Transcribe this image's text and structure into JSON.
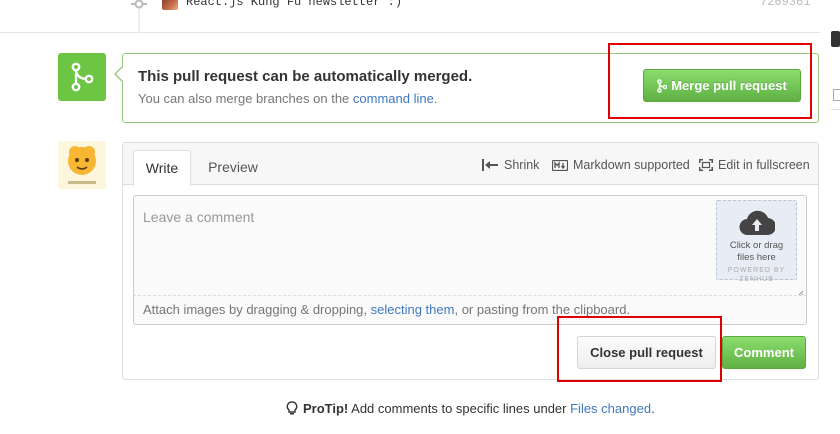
{
  "commit": {
    "message": "React.js Kung Fu newsletter :)",
    "sha": "7269361"
  },
  "merge": {
    "title": "This pull request can be automatically merged.",
    "subtitle_prefix": "You can also merge branches on the ",
    "subtitle_link": "command line",
    "subtitle_suffix": ".",
    "button_label": "Merge pull request"
  },
  "comment_form": {
    "tabs": [
      "Write",
      "Preview"
    ],
    "tools": {
      "shrink": "Shrink",
      "markdown": "Markdown supported",
      "fullscreen": "Edit in fullscreen"
    },
    "placeholder": "Leave a comment",
    "upload": {
      "text_line1": "Click or drag",
      "text_line2": "files here",
      "powered_line1": "POWERED BY",
      "powered_line2": "ZENHUB"
    },
    "attach_prefix": "Attach images by dragging & dropping, ",
    "attach_link": "selecting them",
    "attach_suffix": ", or pasting from the clipboard.",
    "close_button": "Close pull request",
    "comment_button": "Comment"
  },
  "protip": {
    "label": "ProTip!",
    "text": " Add comments to specific lines under ",
    "link": "Files changed",
    "suffix": "."
  },
  "colors": {
    "merge_green": "#6cc644",
    "link_blue": "#4078c0",
    "highlight_red": "#e00000"
  }
}
